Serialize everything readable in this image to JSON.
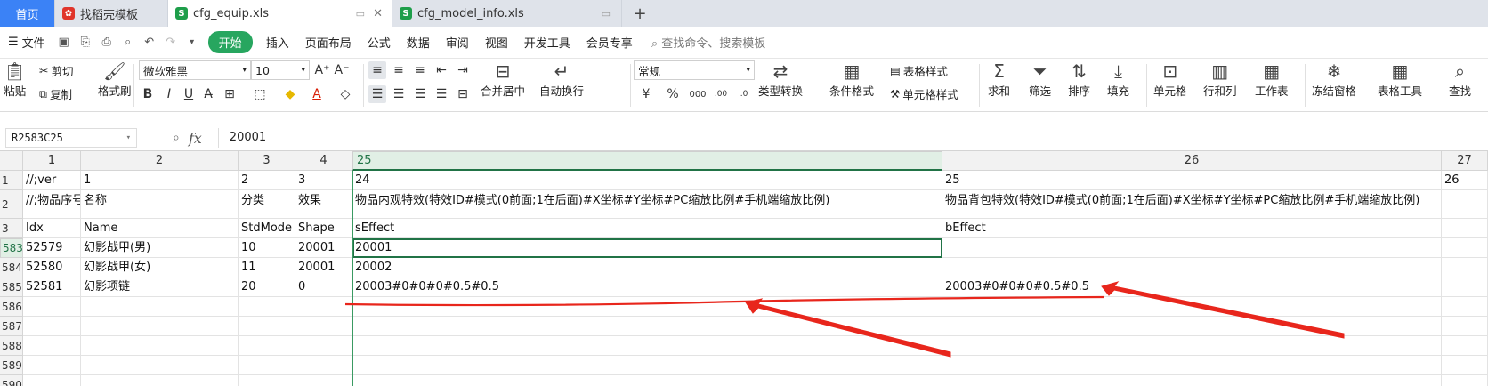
{
  "tabs": {
    "home": "首页",
    "t1": "找稻壳模板",
    "t2": "cfg_equip.xls",
    "t3": "cfg_model_info.xls",
    "add": "+"
  },
  "menu": {
    "file": "文件",
    "start": "开始",
    "items": [
      "插入",
      "页面布局",
      "公式",
      "数据",
      "审阅",
      "视图",
      "开发工具",
      "会员专享"
    ],
    "search": "查找命令、搜索模板"
  },
  "ribbon": {
    "paste": "粘贴",
    "cut": "剪切",
    "copy": "复制",
    "format_painter": "格式刷",
    "font": "微软雅黑",
    "size": "10",
    "merge": "合并居中",
    "wrap": "自动换行",
    "numfmt": "常规",
    "convert": "类型转换",
    "condfmt": "条件格式",
    "tablestyle": "表格样式",
    "cellstyle": "单元格样式",
    "sum": "求和",
    "filter": "筛选",
    "sort": "排序",
    "fill": "填充",
    "cell": "单元格",
    "rowcol": "行和列",
    "sheet": "工作表",
    "freeze": "冻结窗格",
    "tabletools": "表格工具",
    "find": "查找"
  },
  "formula": {
    "namebox": "R2583C25",
    "value": "20001"
  },
  "grid": {
    "col_headers": [
      "1",
      "2",
      "3",
      "4",
      "25",
      "26",
      "27"
    ],
    "row_headers": [
      "1",
      "2",
      "3",
      "583",
      "584",
      "585",
      "586",
      "587",
      "588",
      "589",
      "590"
    ],
    "rows": [
      [
        "//;ver",
        "1",
        "2",
        "3",
        "24",
        "25",
        "26"
      ],
      [
        "//;物品序号",
        "名称",
        "分类",
        "效果",
        "物品内观特效(特效ID#模式(0前面;1在后面)#X坐标#Y坐标#PC缩放比例#手机端缩放比例)",
        "物品背包特效(特效ID#模式(0前面;1在后面)#X坐标#Y坐标#PC缩放比例#手机端缩放比例)",
        ""
      ],
      [
        "Idx",
        "Name",
        "StdMode",
        "Shape",
        "sEffect",
        "bEffect",
        ""
      ],
      [
        "52579",
        "幻影战甲(男)",
        "10",
        "20001",
        "20001",
        "",
        ""
      ],
      [
        "52580",
        "幻影战甲(女)",
        "11",
        "20001",
        "20002",
        "",
        ""
      ],
      [
        "52581",
        "幻影项链",
        "20",
        "0",
        "20003#0#0#0#0.5#0.5",
        "20003#0#0#0#0.5#0.5",
        ""
      ],
      [
        "",
        "",
        "",
        "",
        "",
        "",
        ""
      ],
      [
        "",
        "",
        "",
        "",
        "",
        "",
        ""
      ],
      [
        "",
        "",
        "",
        "",
        "",
        "",
        ""
      ],
      [
        "",
        "",
        "",
        "",
        "",
        "",
        ""
      ],
      [
        "",
        "",
        "",
        "",
        "",
        "",
        ""
      ]
    ]
  },
  "colors": {
    "accent": "#217346",
    "start_green": "#27a65f",
    "annotation": "#e8261c"
  }
}
